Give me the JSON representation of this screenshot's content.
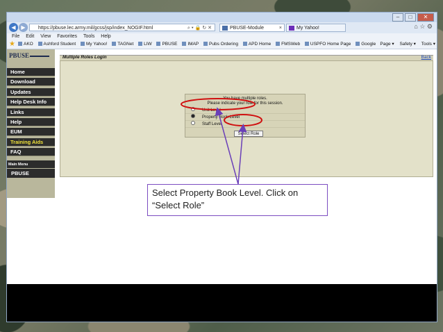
{
  "browser": {
    "url": "https://pbuse.lec.army.mil/gcss/jsp/index_NOGIF.html",
    "tabs": [
      {
        "label": "PBUSE-Module"
      },
      {
        "label": "My Yahoo!"
      }
    ],
    "menu": [
      "File",
      "Edit",
      "View",
      "Favorites",
      "Tools",
      "Help"
    ],
    "favorites": [
      "AKO",
      "Ashford Student",
      "My Yahoo!",
      "TAGNet",
      "LIW",
      "PBUSE",
      "IMAP",
      "Pubs Ordering",
      "APD Home",
      "FMSWeb",
      "USPFO Home Page",
      "Google"
    ],
    "command_bar": [
      "Page ▾",
      "Safety ▾",
      "Tools ▾"
    ]
  },
  "sidebar": {
    "logo": "PBUSE",
    "items": [
      {
        "label": "Home"
      },
      {
        "label": "Download"
      },
      {
        "label": "Updates"
      },
      {
        "label": "Help Desk Info"
      },
      {
        "label": "Links"
      },
      {
        "label": "Help"
      },
      {
        "label": "EUM"
      },
      {
        "label": "Training Aids",
        "highlight": true
      },
      {
        "label": "FAQ"
      }
    ],
    "main_menu_label": "Main Menu",
    "main_menu_item": "PBUSE"
  },
  "content": {
    "title": "Multiple Roles Login",
    "back_label": "Back",
    "message_line1": "You have multiple roles.",
    "message_line2": "Please indicate your role for this session.",
    "roles": [
      {
        "label": "Unit Level",
        "selected": false
      },
      {
        "label": "Property Book Level",
        "selected": true
      },
      {
        "label": "Staff Level",
        "selected": false
      }
    ],
    "select_button": "Select Role"
  },
  "callout": {
    "line1": "Select Property Book Level.  Click on",
    "line2": "“Select Role”"
  },
  "colors": {
    "annotation_red": "#d01010",
    "arrow_purple": "#6a3fb8",
    "nav_bg": "#2c2c2c",
    "highlight_text": "#f0e23a"
  }
}
